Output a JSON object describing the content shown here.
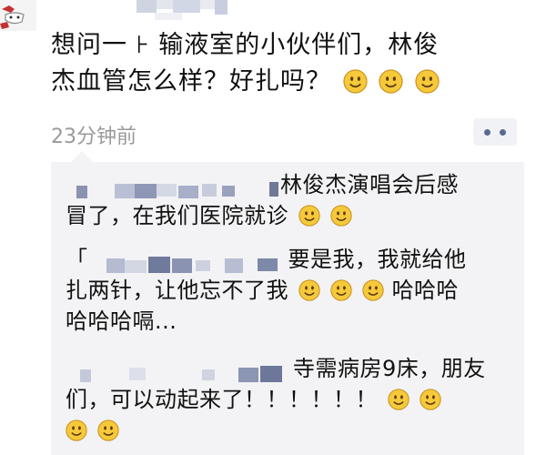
{
  "post": {
    "text": "想问一下输液室的小伙伴们，林俊杰血管怎么样？好扎吗？",
    "line1": "想问一 ⊦ 输液室的小伙伴们，林俊",
    "line2": "杰血管怎么样？好扎吗？",
    "emoji_count": 3,
    "timestamp": "23分钟前"
  },
  "comments": [
    {
      "text_line1": "林俊杰演唱会后感",
      "text_line2": "冒了，在我们医院就诊",
      "emoji_after_line2": 2
    },
    {
      "prefix": "「",
      "text_line1": "要是我，我就给他",
      "text_line2a": "扎两针，让他忘不了我",
      "text_line2b": "哈哈哈",
      "text_line3": "哈哈哈嗝...",
      "emoji_mid_line2": 3
    },
    {
      "text_line1": "寺需病房9床，朋友",
      "text_line2": "们，可以动起来了！！！！！！",
      "emoji_after_line2": 2,
      "emoji_line3": 2
    }
  ],
  "icons": {
    "emoji": "smiley-face-icon",
    "more": "more-dots-icon"
  },
  "colors": {
    "accent_dots": "#5a6b92",
    "timestamp": "#9a9a9a",
    "comment_bg": "#f3f3f5",
    "emoji_face": "#f5c93a"
  }
}
